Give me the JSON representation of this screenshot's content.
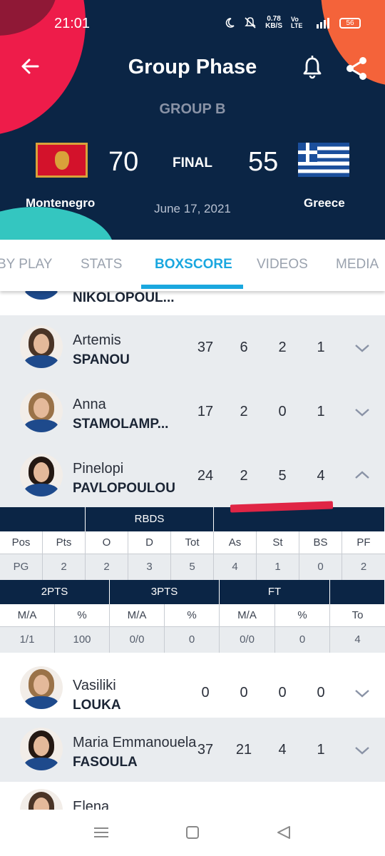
{
  "status_bar": {
    "time": "21:01",
    "net_speed": "0.78",
    "net_unit": "KB/S",
    "net_type": "Vo LTE",
    "signal": "4G",
    "battery": "56"
  },
  "header": {
    "title": "Group Phase",
    "group": "GROUP B",
    "status": "FINAL",
    "date": "June 17, 2021",
    "home_team": {
      "name": "Montenegro",
      "score": "70"
    },
    "away_team": {
      "name": "Greece",
      "score": "55"
    }
  },
  "tabs": [
    {
      "label": "BY PLAY"
    },
    {
      "label": "STATS"
    },
    {
      "label": "BOXSCORE"
    },
    {
      "label": "VIDEOS"
    },
    {
      "label": "MEDIA"
    }
  ],
  "players": [
    {
      "first": "",
      "last": "NIKOLOPOUL...",
      "stats": []
    },
    {
      "first": "Artemis",
      "last": "SPANOU",
      "stats": [
        "37",
        "6",
        "2",
        "1"
      ]
    },
    {
      "first": "Anna",
      "last": "STAMOLAMP...",
      "stats": [
        "17",
        "2",
        "0",
        "1"
      ]
    },
    {
      "first": "Pinelopi",
      "last": "PAVLOPOULOU",
      "stats": [
        "24",
        "2",
        "5",
        "4"
      ]
    },
    {
      "first": "Vasiliki",
      "last": "LOUKA",
      "stats": [
        "0",
        "0",
        "0",
        "0"
      ]
    },
    {
      "first": "Maria Emmanouela",
      "last": "FASOULA",
      "stats": [
        "37",
        "21",
        "4",
        "1"
      ]
    },
    {
      "first": "Elena",
      "last": "",
      "stats": []
    }
  ],
  "detail": {
    "group1": "RBDS",
    "cols1": [
      "Pos",
      "Pts",
      "O",
      "D",
      "Tot",
      "As",
      "St",
      "BS",
      "PF"
    ],
    "vals1": [
      "PG",
      "2",
      "2",
      "3",
      "5",
      "4",
      "1",
      "0",
      "2"
    ],
    "group2": [
      "2PTS",
      "3PTS",
      "FT"
    ],
    "cols2": [
      "M/A",
      "%",
      "M/A",
      "%",
      "M/A",
      "%",
      "To"
    ],
    "vals2": [
      "1/1",
      "100",
      "0/0",
      "0",
      "0/0",
      "0",
      "4"
    ]
  },
  "colors": {
    "header_bg": "#0b2545",
    "accent": "#1aa7df",
    "row_alt": "#e9ecef",
    "annotation": "#e02545"
  }
}
